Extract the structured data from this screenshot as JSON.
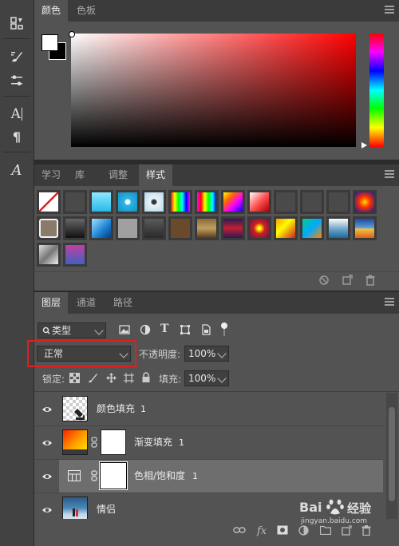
{
  "color_panel": {
    "tabs": [
      {
        "label": "颜色",
        "active": true
      },
      {
        "label": "色板",
        "active": false
      }
    ],
    "foreground_color": "#ffffff",
    "background_color": "#000000",
    "hue_color": "#ff0000"
  },
  "styles_panel": {
    "tabs": [
      {
        "label": "学习",
        "active": false
      },
      {
        "label": "库",
        "active": false
      },
      {
        "label": "调整",
        "active": false
      },
      {
        "label": "样式",
        "active": true
      }
    ],
    "footer_icons": [
      "clear-style-icon",
      "new-style-icon",
      "delete-style-icon"
    ]
  },
  "layers_panel": {
    "tabs": [
      {
        "label": "图层",
        "active": true
      },
      {
        "label": "通道",
        "active": false
      },
      {
        "label": "路径",
        "active": false
      }
    ],
    "filter_label": "类型",
    "blend_mode": "正常",
    "opacity_label": "不透明度:",
    "opacity_value": "100%",
    "lock_label": "锁定:",
    "fill_label": "填充:",
    "fill_value": "100%",
    "layers": [
      {
        "name": "颜色填充",
        "suffix": "1",
        "thumb": "fill",
        "selected": false,
        "visible": true
      },
      {
        "name": "渐变填充",
        "suffix": "1",
        "thumb": "gradient",
        "selected": false,
        "visible": true
      },
      {
        "name": "色相/饱和度",
        "suffix": "1",
        "thumb": "adjust",
        "selected": true,
        "visible": true
      },
      {
        "name": "情侣",
        "suffix": "",
        "thumb": "photo",
        "selected": false,
        "visible": true
      }
    ],
    "fx_label": "fx"
  },
  "watermark": "Bai 经验 jingyan.baidu.com",
  "highlight_color": "#e02020"
}
